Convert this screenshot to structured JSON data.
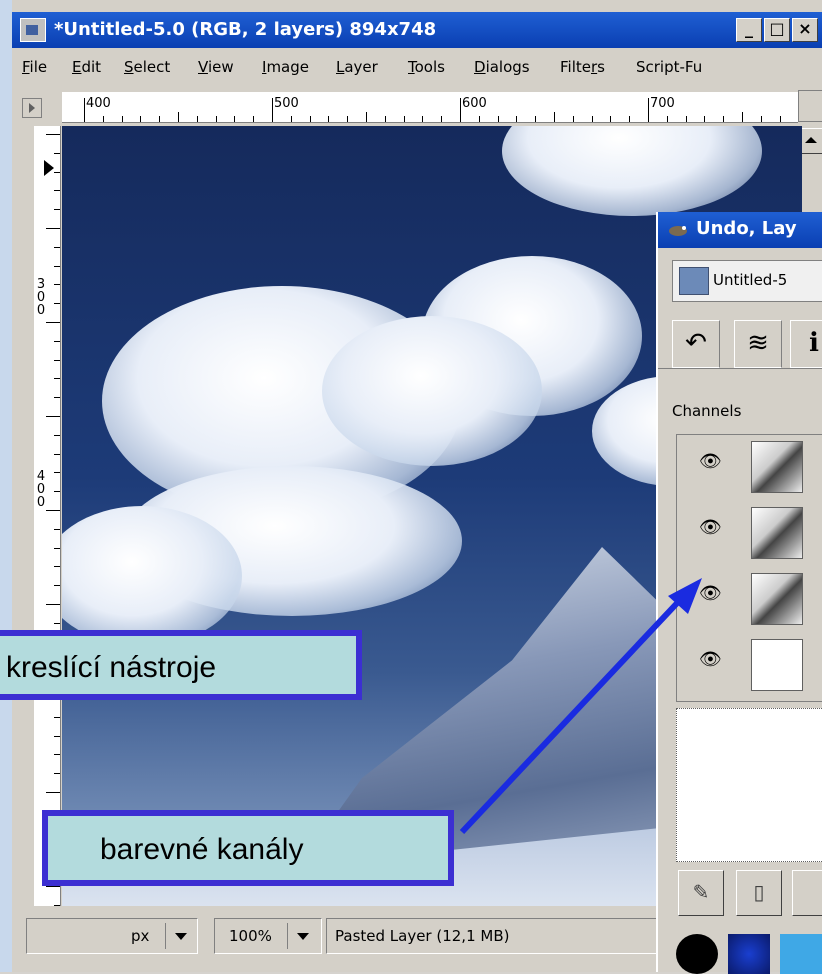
{
  "window": {
    "title": "*Untitled-5.0 (RGB, 2 layers) 894x748",
    "buttons": {
      "minimize": "_",
      "maximize": "□",
      "close": "×"
    }
  },
  "menubar": {
    "items": [
      {
        "label": "File",
        "u": "F",
        "rest": "ile"
      },
      {
        "label": "Edit",
        "u": "E",
        "rest": "dit"
      },
      {
        "label": "Select",
        "u": "S",
        "rest": "elect"
      },
      {
        "label": "View",
        "u": "V",
        "rest": "iew"
      },
      {
        "label": "Image",
        "u": "I",
        "rest": "mage"
      },
      {
        "label": "Layer",
        "u": "L",
        "rest": "ayer"
      },
      {
        "label": "Tools",
        "u": "T",
        "rest": "ools"
      },
      {
        "label": "Dialogs",
        "u": "D",
        "rest": "ialogs"
      },
      {
        "label": "Filters",
        "pre": "Filte",
        "u": "r",
        "rest": "s"
      },
      {
        "label": "Script-Fu",
        "pre": "Script-Fu",
        "u": "",
        "rest": ""
      }
    ]
  },
  "ruler_top": {
    "labels": [
      "400",
      "500",
      "600",
      "700"
    ]
  },
  "ruler_left": {
    "labels": [
      "300",
      "400"
    ]
  },
  "statusbar": {
    "unit": "px",
    "zoom": "100%",
    "info": "Pasted Layer (12,1 MB)"
  },
  "dock": {
    "title": "Undo, Lay",
    "image_selector": "Untitled-5",
    "tab_icons": [
      "undo-icon",
      "layers-icon",
      "info-icon"
    ],
    "channels_label": "Channels",
    "channels": [
      {
        "name": "red-channel",
        "visible": true
      },
      {
        "name": "green-channel",
        "visible": true
      },
      {
        "name": "blue-channel",
        "visible": true
      },
      {
        "name": "alpha-channel",
        "visible": true
      }
    ],
    "swatch_colors": [
      "#000000",
      "#1a3fd0",
      "#3fa8e6"
    ]
  },
  "callouts": {
    "tools": "kreslící nástroje",
    "channels": "barevné kanály"
  },
  "colors": {
    "titlebar": "#0a3fb2",
    "callout_border": "#3c2fd2",
    "callout_fill": "#b3dbdd"
  }
}
